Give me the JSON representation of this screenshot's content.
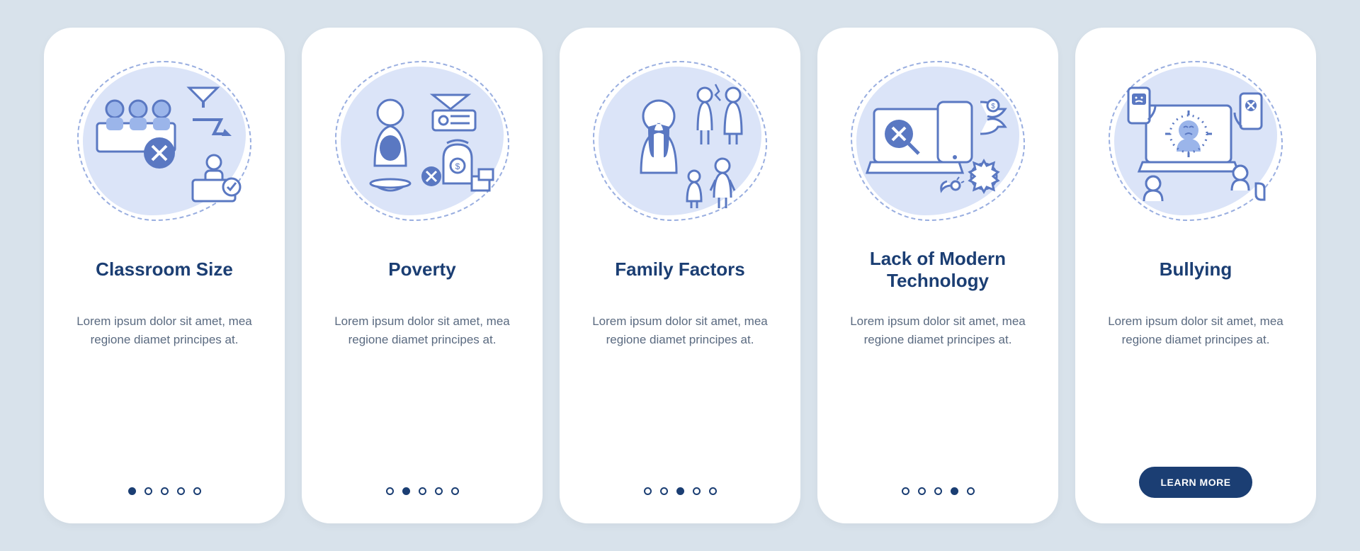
{
  "shared": {
    "description": "Lorem ipsum dolor sit amet, mea regione diamet principes at.",
    "button_label": "LEARN MORE"
  },
  "cards": [
    {
      "title": "Classroom Size",
      "icon": "classroom-group-icon",
      "active_dot": 0,
      "has_button": false
    },
    {
      "title": "Poverty",
      "icon": "poverty-bowl-icon",
      "active_dot": 1,
      "has_button": false
    },
    {
      "title": "Family Factors",
      "icon": "family-stress-icon",
      "active_dot": 2,
      "has_button": false
    },
    {
      "title": "Lack of Modern Technology",
      "icon": "laptop-error-icon",
      "active_dot": 3,
      "has_button": false
    },
    {
      "title": "Bullying",
      "icon": "cyberbullying-icon",
      "active_dot": 4,
      "has_button": true
    }
  ]
}
